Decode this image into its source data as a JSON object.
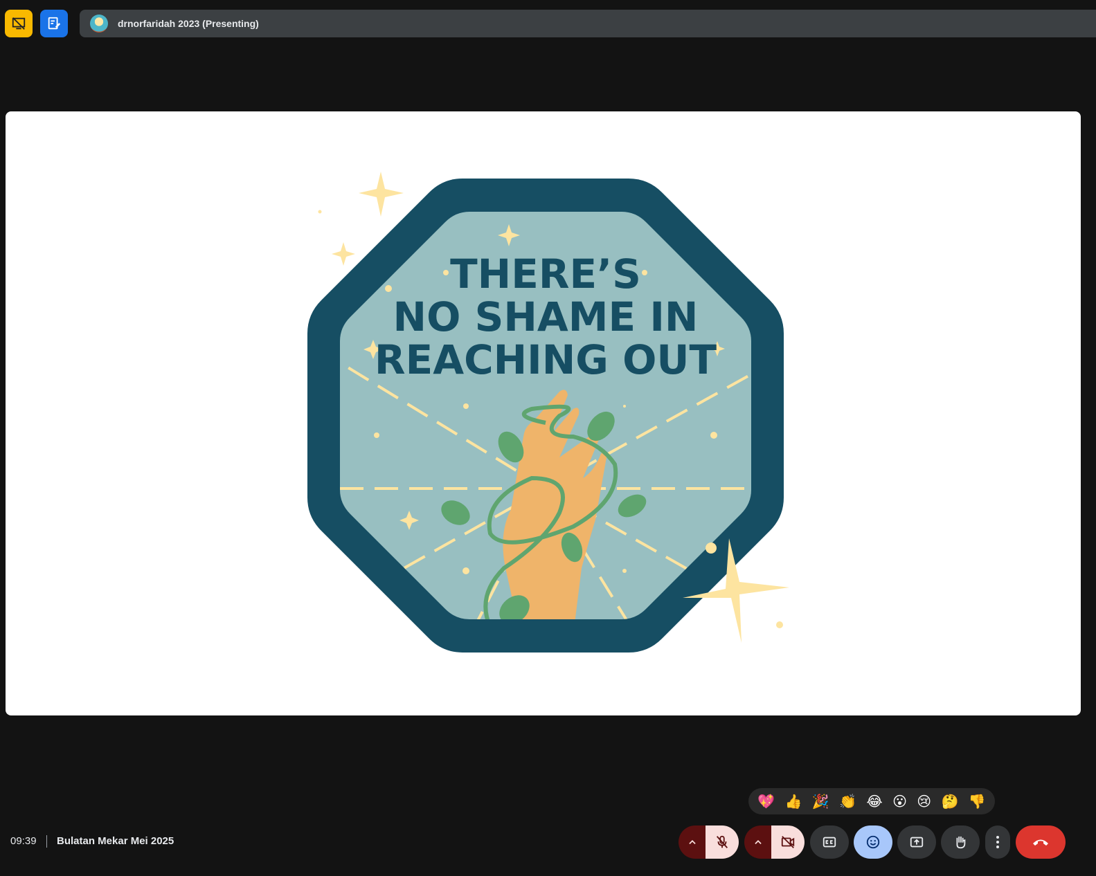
{
  "topbar": {
    "presenter_label": "drnorfaridah 2023 (Presenting)",
    "left_icons": [
      "presentation-off-icon",
      "notes-edit-icon"
    ]
  },
  "slide": {
    "line1": "THERE’S",
    "line2": "NO SHAME IN",
    "line3": "REACHING OUT",
    "colors": {
      "octagon_outer": "#164e63",
      "octagon_inner": "#98bfc1",
      "text": "#164e63",
      "accent": "#fde4a0",
      "hand": "#efb46a",
      "vine": "#5fa56f"
    }
  },
  "reactions": [
    "💖",
    "👍",
    "🎉",
    "👏",
    "😂",
    "😮",
    "😢",
    "🤔",
    "👎"
  ],
  "footer": {
    "time": "09:39",
    "meeting_title": "Bulatan Mekar Mei 2025"
  },
  "controls": {
    "mic": "mic-off-icon",
    "camera": "camera-off-icon",
    "captions": "captions-icon",
    "emoji": "emoji-icon",
    "present": "present-screen-icon",
    "raise_hand": "raise-hand-icon",
    "more": "more-vert-icon",
    "leave": "leave-call-icon",
    "colors": {
      "leave": "#dc362e",
      "emoji_active": "#a8c7fa",
      "muted_bg": "#f9dedc"
    }
  }
}
